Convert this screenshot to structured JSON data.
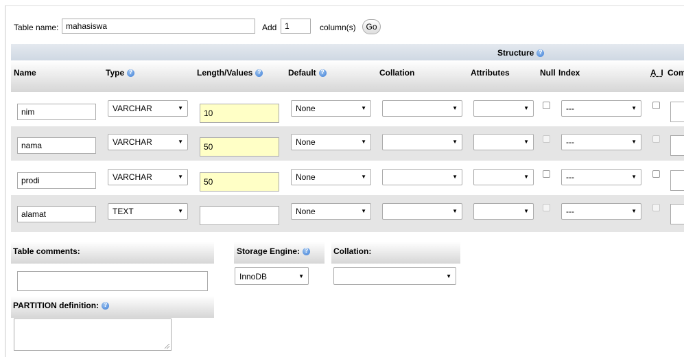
{
  "table_form": {
    "table_name_label": "Table name:",
    "table_name_value": "mahasiswa",
    "add_label": "Add",
    "add_count": "1",
    "columns_label": "column(s)",
    "go_label": "Go"
  },
  "structure_label": "Structure",
  "headers": {
    "name": "Name",
    "type": "Type",
    "length": "Length/Values",
    "default": "Default",
    "collation": "Collation",
    "attributes": "Attributes",
    "null": "Null",
    "index": "Index",
    "ai": "A_I",
    "comments": "Com"
  },
  "rows": [
    {
      "name": "nim",
      "type": "VARCHAR",
      "length": "10",
      "default": "None",
      "collation": "",
      "attributes": "",
      "null": false,
      "index": "---",
      "ai": false
    },
    {
      "name": "nama",
      "type": "VARCHAR",
      "length": "50",
      "default": "None",
      "collation": "",
      "attributes": "",
      "null": false,
      "index": "---",
      "ai": false
    },
    {
      "name": "prodi",
      "type": "VARCHAR",
      "length": "50",
      "default": "None",
      "collation": "",
      "attributes": "",
      "null": false,
      "index": "---",
      "ai": false
    },
    {
      "name": "alamat",
      "type": "TEXT",
      "length": "",
      "default": "None",
      "collation": "",
      "attributes": "",
      "null": false,
      "index": "---",
      "ai": false
    }
  ],
  "table_comments": {
    "label": "Table comments:",
    "value": ""
  },
  "storage_engine": {
    "label": "Storage Engine:",
    "value": "InnoDB"
  },
  "table_collation": {
    "label": "Collation:",
    "value": ""
  },
  "partition": {
    "label": "PARTITION definition:",
    "value": ""
  },
  "colors": {
    "highlight_field": "#ffffc6",
    "structure_band": "#d8dfe8",
    "row_even": "#e5e5e5"
  }
}
